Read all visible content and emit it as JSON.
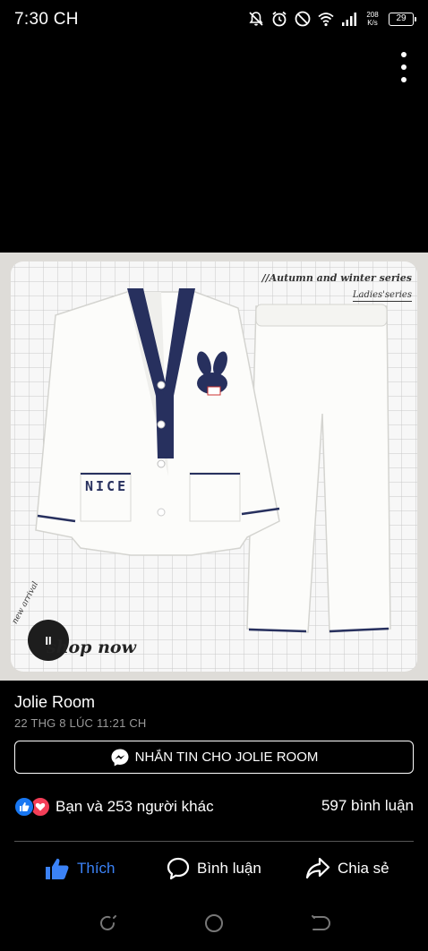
{
  "status_bar": {
    "time": "7:30 CH",
    "net_speed_value": "208",
    "net_speed_unit": "K/s",
    "battery": "29",
    "icons": [
      "mute-icon",
      "alarm-icon",
      "dnd-icon",
      "wifi-icon",
      "signal-icon",
      "battery-icon"
    ]
  },
  "photo": {
    "series_line1": "//Autumn and winter series",
    "series_line2": "Ladies'series",
    "pajama_text": "NICE",
    "badge_text": "NICE",
    "pause_label": "II",
    "shop_now": "shop now",
    "new_arrival": "new arrival"
  },
  "post": {
    "author": "Jolie Room",
    "timestamp": "22 THG 8 LÚC 11:21 CH",
    "message_button": "NHẮN TIN CHO JOLIE ROOM",
    "reactions_text": "Bạn và 253 người khác",
    "comments_count": "597 bình luận"
  },
  "actions": {
    "like": "Thích",
    "comment": "Bình luận",
    "share": "Chia sẻ"
  },
  "colors": {
    "like_blue": "#3b82f6",
    "love_red": "#f33e58",
    "navy_trim": "#27305e"
  }
}
